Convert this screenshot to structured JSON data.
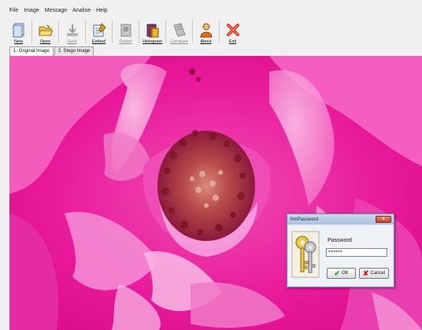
{
  "menu": [
    "File",
    "Image",
    "Message",
    "Analise",
    "Help"
  ],
  "toolbar": {
    "buttons": [
      {
        "label": "New",
        "icon": "new-file-icon",
        "enabled": true
      },
      {
        "label": "Open",
        "icon": "open-folder-icon",
        "enabled": true
      },
      {
        "label": "Save",
        "icon": "save-icon",
        "enabled": false
      },
      {
        "label": "Embed",
        "icon": "embed-icon",
        "enabled": true
      },
      {
        "label": "Detect",
        "icon": "detect-icon",
        "enabled": false
      },
      {
        "label": "Histogram",
        "icon": "histogram-icon",
        "enabled": true
      },
      {
        "label": "Compare",
        "icon": "compare-icon",
        "enabled": false
      },
      {
        "label": "About",
        "icon": "user-icon",
        "enabled": true
      },
      {
        "label": "Exit",
        "icon": "exit-icon",
        "enabled": true
      }
    ]
  },
  "tabs": [
    {
      "label": "1. Original Image",
      "active": true
    },
    {
      "label": "2. Stego Image",
      "active": false
    }
  ],
  "dialog": {
    "title": "frmPassword",
    "close_label": "x",
    "password_label": "Password",
    "password_value": "******",
    "ok_label": "OK",
    "cancel_label": "Cancel",
    "ok_icon": "check-icon",
    "cancel_icon": "cancel-x-icon"
  },
  "colors": {
    "flower": "#e8189a",
    "flower_light": "#f59fd8",
    "stamen": "#9c2a2a",
    "dialog_bg": "#d9e3ef",
    "close_button": "#c9432a"
  }
}
